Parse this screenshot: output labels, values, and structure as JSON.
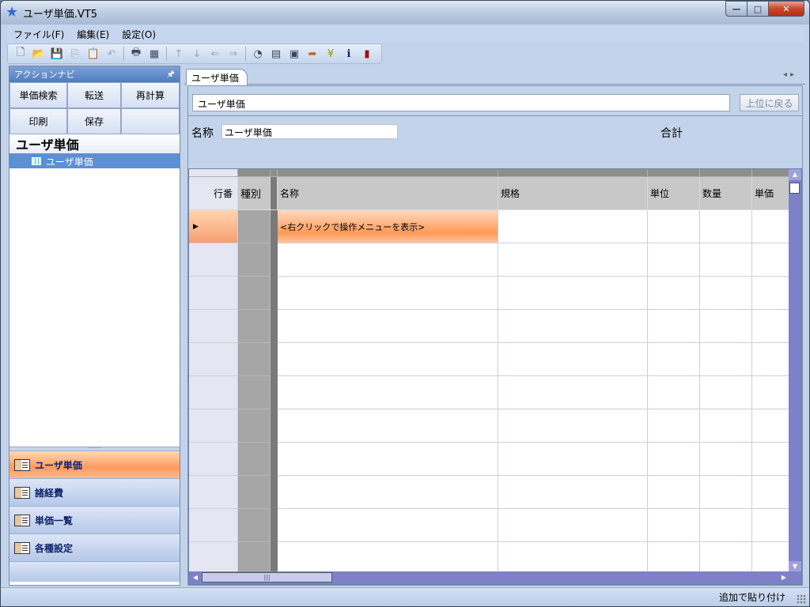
{
  "window": {
    "title": "ユーザ単価.VT5",
    "min": "—",
    "max": "□",
    "close": "✕"
  },
  "menu": [
    {
      "label": "ファイル(F)"
    },
    {
      "label": "編集(E)"
    },
    {
      "label": "設定(O)"
    }
  ],
  "action_nav": {
    "header": "アクションナビ",
    "pin": "🖈",
    "buttons": [
      "単価検索",
      "転送",
      "再計算",
      "印刷",
      "保存",
      ""
    ],
    "section_title": "ユーザ単価",
    "tree_item": "ユーザ単価",
    "nav_items": [
      {
        "label": "ユーザ単価",
        "active": true
      },
      {
        "label": "諸経費",
        "active": false
      },
      {
        "label": "単価一覧",
        "active": false
      },
      {
        "label": "各種設定",
        "active": false
      }
    ]
  },
  "doc": {
    "tab": "ユーザ単価",
    "path_value": "ユーザ単価",
    "back_button": "上位に戻る",
    "name_label": "名称",
    "name_value": "ユーザ単価",
    "total_label": "合計"
  },
  "grid": {
    "headers": {
      "row_no": "行番",
      "kind": "種別",
      "name": "名称",
      "spec": "規格",
      "unit": "単位",
      "qty": "数量",
      "price": "単価"
    },
    "current_row_marker": "▶",
    "hint_text": "<右クリックで操作メニューを表示>",
    "empty_rows": 10
  },
  "status": {
    "text": "追加で貼り付け"
  }
}
